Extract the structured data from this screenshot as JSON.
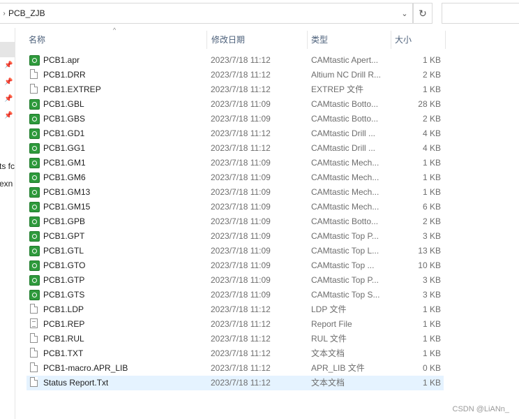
{
  "address_bar": {
    "path": "PCB_ZJB",
    "chevron_icon": "chevron-right-icon",
    "dropdown_icon": "chevron-down-icon"
  },
  "refresh_icon": "refresh-icon",
  "nav": {
    "fragment_1": "ts fc",
    "fragment_2": "exn"
  },
  "columns": {
    "name": "名称",
    "date": "修改日期",
    "type": "类型",
    "size": "大小"
  },
  "files": [
    {
      "name": "PCB1.apr",
      "date": "2023/7/18 11:12",
      "type": "CAMtastic Apert...",
      "size": "1 KB",
      "icon": "camtastic-file-icon"
    },
    {
      "name": "PCB1.DRR",
      "date": "2023/7/18 11:12",
      "type": "Altium NC Drill R...",
      "size": "2 KB",
      "icon": "generic-file-icon"
    },
    {
      "name": "PCB1.EXTREP",
      "date": "2023/7/18 11:12",
      "type": "EXTREP 文件",
      "size": "1 KB",
      "icon": "generic-file-icon"
    },
    {
      "name": "PCB1.GBL",
      "date": "2023/7/18 11:09",
      "type": "CAMtastic Botto...",
      "size": "28 KB",
      "icon": "camtastic-file-icon"
    },
    {
      "name": "PCB1.GBS",
      "date": "2023/7/18 11:09",
      "type": "CAMtastic Botto...",
      "size": "2 KB",
      "icon": "camtastic-file-icon"
    },
    {
      "name": "PCB1.GD1",
      "date": "2023/7/18 11:12",
      "type": "CAMtastic Drill ...",
      "size": "4 KB",
      "icon": "camtastic-file-icon"
    },
    {
      "name": "PCB1.GG1",
      "date": "2023/7/18 11:12",
      "type": "CAMtastic Drill ...",
      "size": "4 KB",
      "icon": "camtastic-file-icon"
    },
    {
      "name": "PCB1.GM1",
      "date": "2023/7/18 11:09",
      "type": "CAMtastic Mech...",
      "size": "1 KB",
      "icon": "camtastic-file-icon"
    },
    {
      "name": "PCB1.GM6",
      "date": "2023/7/18 11:09",
      "type": "CAMtastic Mech...",
      "size": "1 KB",
      "icon": "camtastic-file-icon"
    },
    {
      "name": "PCB1.GM13",
      "date": "2023/7/18 11:09",
      "type": "CAMtastic Mech...",
      "size": "1 KB",
      "icon": "camtastic-file-icon"
    },
    {
      "name": "PCB1.GM15",
      "date": "2023/7/18 11:09",
      "type": "CAMtastic Mech...",
      "size": "6 KB",
      "icon": "camtastic-file-icon"
    },
    {
      "name": "PCB1.GPB",
      "date": "2023/7/18 11:09",
      "type": "CAMtastic Botto...",
      "size": "2 KB",
      "icon": "camtastic-file-icon"
    },
    {
      "name": "PCB1.GPT",
      "date": "2023/7/18 11:09",
      "type": "CAMtastic Top P...",
      "size": "3 KB",
      "icon": "camtastic-file-icon"
    },
    {
      "name": "PCB1.GTL",
      "date": "2023/7/18 11:09",
      "type": "CAMtastic Top L...",
      "size": "13 KB",
      "icon": "camtastic-file-icon"
    },
    {
      "name": "PCB1.GTO",
      "date": "2023/7/18 11:09",
      "type": "CAMtastic Top ...",
      "size": "10 KB",
      "icon": "camtastic-file-icon"
    },
    {
      "name": "PCB1.GTP",
      "date": "2023/7/18 11:09",
      "type": "CAMtastic Top P...",
      "size": "3 KB",
      "icon": "camtastic-file-icon"
    },
    {
      "name": "PCB1.GTS",
      "date": "2023/7/18 11:09",
      "type": "CAMtastic Top S...",
      "size": "3 KB",
      "icon": "camtastic-file-icon"
    },
    {
      "name": "PCB1.LDP",
      "date": "2023/7/18 11:12",
      "type": "LDP 文件",
      "size": "1 KB",
      "icon": "generic-file-icon"
    },
    {
      "name": "PCB1.REP",
      "date": "2023/7/18 11:12",
      "type": "Report File",
      "size": "1 KB",
      "icon": "text-file-icon"
    },
    {
      "name": "PCB1.RUL",
      "date": "2023/7/18 11:12",
      "type": "RUL 文件",
      "size": "1 KB",
      "icon": "generic-file-icon"
    },
    {
      "name": "PCB1.TXT",
      "date": "2023/7/18 11:12",
      "type": "文本文档",
      "size": "1 KB",
      "icon": "generic-file-icon"
    },
    {
      "name": "PCB1-macro.APR_LIB",
      "date": "2023/7/18 11:12",
      "type": "APR_LIB 文件",
      "size": "0 KB",
      "icon": "generic-file-icon"
    },
    {
      "name": "Status Report.Txt",
      "date": "2023/7/18 11:12",
      "type": "文本文档",
      "size": "1 KB",
      "icon": "generic-file-icon",
      "selected": true
    }
  ],
  "watermark": "CSDN @LiANn_",
  "colors": {
    "selected_row": "#e5f3ff",
    "header_text": "#4c607a",
    "camtastic_icon": "#2e9a3c"
  }
}
